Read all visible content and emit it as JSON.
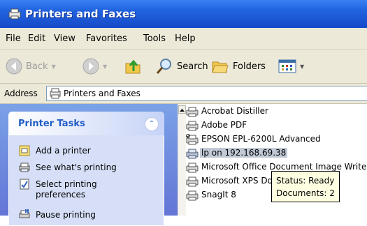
{
  "window": {
    "title": "Printers and Faxes"
  },
  "menu": [
    "File",
    "Edit",
    "View",
    "Favorites",
    "Tools",
    "Help"
  ],
  "toolbar": {
    "back_label": "Back",
    "search_label": "Search",
    "folders_label": "Folders"
  },
  "address": {
    "label": "Address",
    "value": "Printers and Faxes"
  },
  "tasks": {
    "title": "Printer Tasks",
    "items": [
      {
        "label": "Add a printer",
        "icon": "add-printer-icon"
      },
      {
        "label": "See what's printing",
        "icon": "print-queue-icon"
      },
      {
        "label": "Select printing preferences",
        "line1": "Select printing",
        "line2": "preferences",
        "icon": "preferences-icon"
      },
      {
        "label": "Pause printing",
        "icon": "pause-printer-icon"
      }
    ]
  },
  "printers": [
    {
      "name": "Acrobat Distiller"
    },
    {
      "name": "Adobe PDF"
    },
    {
      "name": "EPSON EPL-6200L Advanced",
      "default": true
    },
    {
      "name": "lp on 192.168.69.38",
      "selected": true,
      "network": true
    },
    {
      "name": "Microsoft Office Document Image Writer"
    },
    {
      "name": "Microsoft XPS Document Writer"
    },
    {
      "name": "SnagIt 8"
    }
  ],
  "tooltip": {
    "status": "Status: Ready",
    "documents": "Documents: 2"
  },
  "colors": {
    "title_bar": "#2265e0",
    "task_pane": "#6375d6",
    "task_title": "#215dc6",
    "selection": "#c1c9d6",
    "tooltip_bg": "#ffffe1"
  }
}
